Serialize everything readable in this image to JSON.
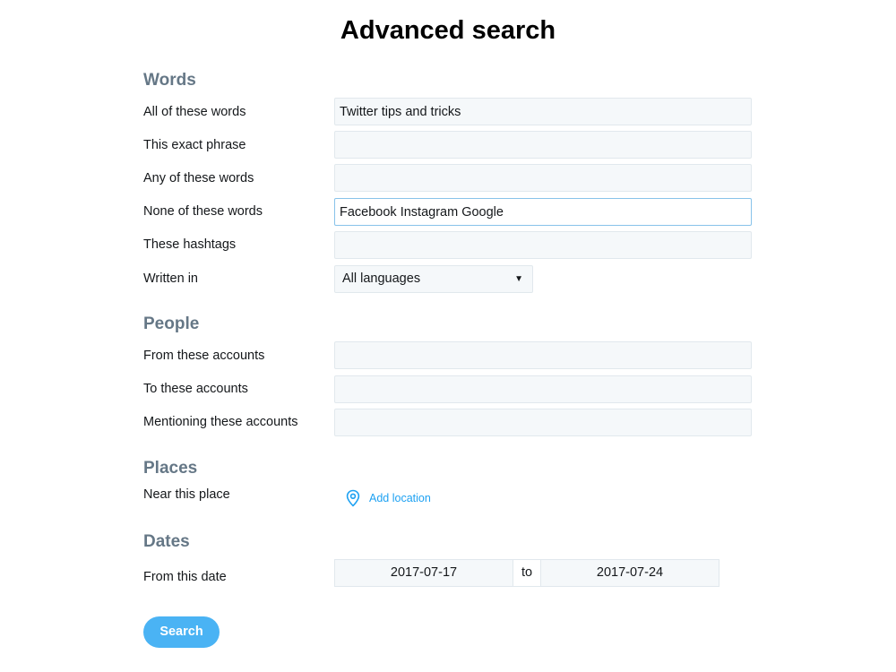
{
  "page": {
    "title": "Advanced search"
  },
  "words": {
    "heading": "Words",
    "all_label": "All of these words",
    "all_value": "Twitter tips and tricks",
    "exact_label": "This exact phrase",
    "exact_value": "",
    "any_label": "Any of these words",
    "any_value": "",
    "none_label": "None of these words",
    "none_value": "Facebook Instagram Google",
    "hashtags_label": "These hashtags",
    "hashtags_value": "",
    "language_label": "Written in",
    "language_value": "All languages"
  },
  "people": {
    "heading": "People",
    "from_label": "From these accounts",
    "to_label": "To these accounts",
    "mention_label": "Mentioning these accounts"
  },
  "places": {
    "heading": "Places",
    "near_label": "Near this place",
    "add_location": "Add location",
    "icon": "location-pin-icon"
  },
  "dates": {
    "heading": "Dates",
    "from_label": "From this date",
    "start": "2017-07-17",
    "separator": "to",
    "end": "2017-07-24"
  },
  "actions": {
    "search_label": "Search"
  },
  "colors": {
    "accent": "#1da1f2",
    "button": "#4ab3f4",
    "section": "#657786",
    "field_bg": "#f5f8fa"
  }
}
